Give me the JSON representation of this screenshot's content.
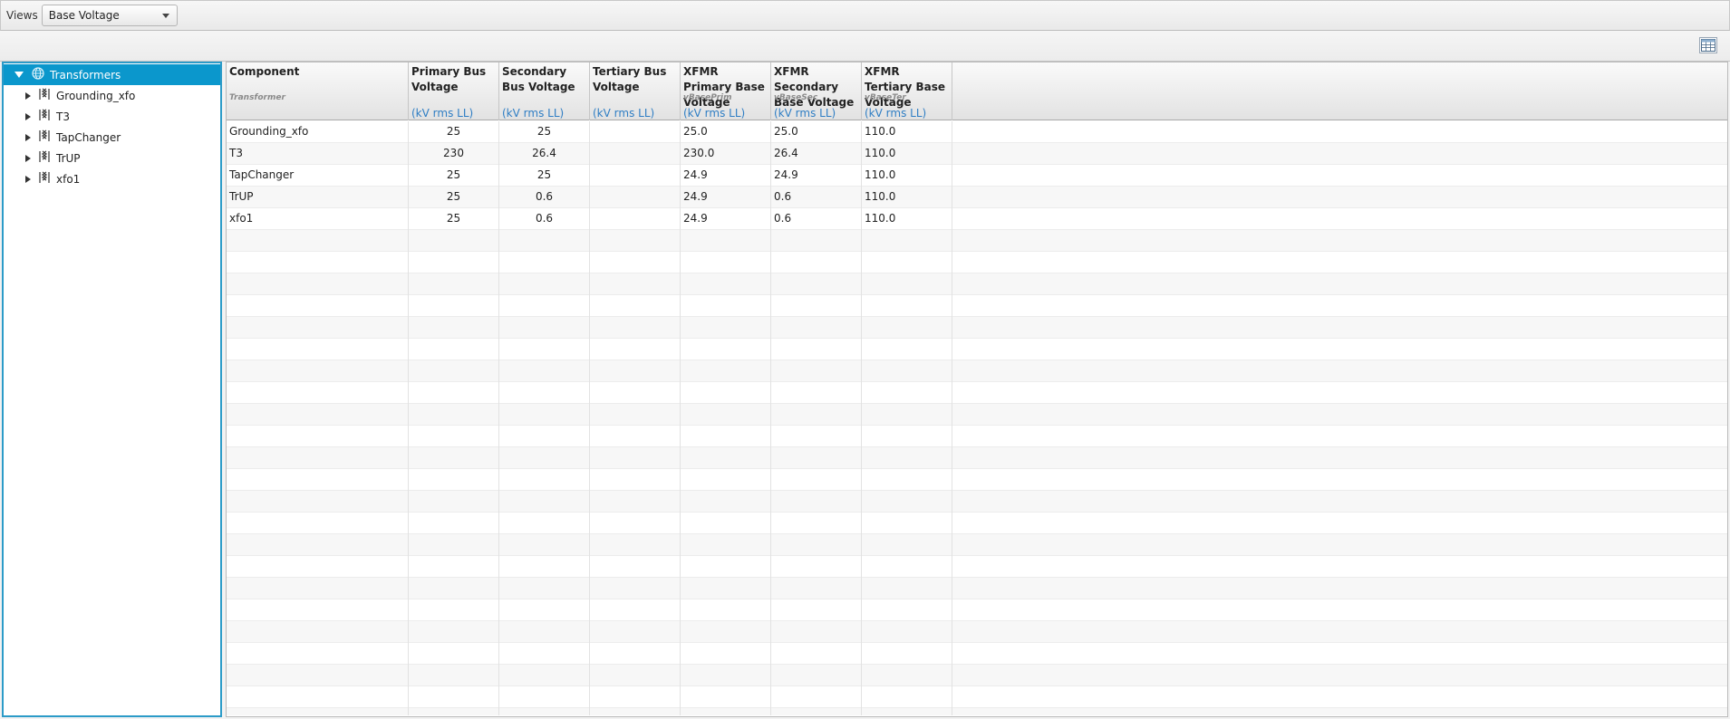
{
  "toolbar": {
    "views_label": "Views",
    "views_selected": "Base Voltage"
  },
  "tree": {
    "root_label": "Transformers",
    "items": [
      {
        "label": "Grounding_xfo"
      },
      {
        "label": "T3"
      },
      {
        "label": "TapChanger"
      },
      {
        "label": "TrUP"
      },
      {
        "label": "xfo1"
      }
    ]
  },
  "table": {
    "columns": [
      {
        "name": "Component",
        "prop": "Transformer",
        "unit": ""
      },
      {
        "name": "Primary Bus Voltage",
        "prop": "",
        "unit": "(kV rms LL)"
      },
      {
        "name": "Secondary Bus Voltage",
        "prop": "",
        "unit": "(kV rms LL)"
      },
      {
        "name": "Tertiary Bus Voltage",
        "prop": "",
        "unit": "(kV rms LL)"
      },
      {
        "name": "XFMR Primary Base Voltage",
        "prop": "vBasePrim",
        "unit": "(kV rms LL)"
      },
      {
        "name": "XFMR Secondary Base Voltage",
        "prop": "vBaseSec",
        "unit": "(kV rms LL)"
      },
      {
        "name": "XFMR Tertiary Base Voltage",
        "prop": "vBaseTer",
        "unit": "(kV rms LL)"
      }
    ],
    "rows": [
      [
        "Grounding_xfo",
        "25",
        "25",
        "",
        "25.0",
        "25.0",
        "110.0"
      ],
      [
        "T3",
        "230",
        "26.4",
        "",
        "230.0",
        "26.4",
        "110.0"
      ],
      [
        "TapChanger",
        "25",
        "25",
        "",
        "24.9",
        "24.9",
        "110.0"
      ],
      [
        "TrUP",
        "25",
        "0.6",
        "",
        "24.9",
        "0.6",
        "110.0"
      ],
      [
        "xfo1",
        "25",
        "0.6",
        "",
        "24.9",
        "0.6",
        "110.0"
      ]
    ]
  }
}
